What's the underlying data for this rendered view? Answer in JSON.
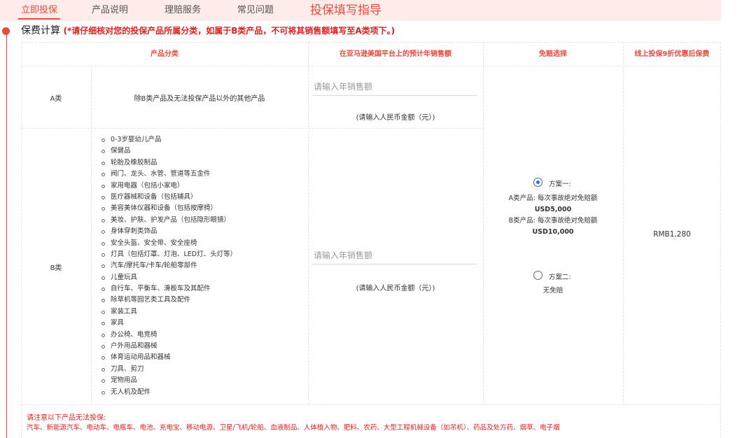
{
  "nav": {
    "tabs": [
      {
        "label": "立即投保",
        "active": true
      },
      {
        "label": "产品说明"
      },
      {
        "label": "理赔服务"
      },
      {
        "label": "常见问题"
      },
      {
        "label": "投保填写指导"
      }
    ],
    "active_color": "#e74b3c",
    "bar_color": "#fdecea"
  },
  "section": {
    "title": "保费计算",
    "note": "(*请仔细核对您的投保产品所属分类，如属于B类产品，不可将其销售额填写至A类项下。)"
  },
  "table": {
    "headers": [
      "产品分类",
      "在亚马逊美国平台上的预计年销售额",
      "免赔选择",
      "线上投保9折优惠后保费"
    ],
    "rows": {
      "a": {
        "label": "A类",
        "description": "除B类产品及无法投保产品以外的其他产品",
        "sales_placeholder": "请输入年销售额",
        "sales_hint": "(请输入人民币金额（元）)"
      },
      "b": {
        "label": "B类",
        "items": [
          "0-3岁婴幼儿产品",
          "保健品",
          "轮胎及橡胶制品",
          "阀门、龙头、水管、管道等五金件",
          "家用电器（包括小家电）",
          "医疗器械和设备（包括辅具）",
          "美容美体仪器和设备（包括按摩椅）",
          "美妆、护肤、护发产品（包括隐形眼镜）",
          "身体穿刺类饰品",
          "安全头盔、安全带、安全座椅",
          "灯具（包括灯罩、灯泡、LED灯、头灯等）",
          "汽车/摩托车/卡车/轮船零部件",
          "儿童玩具",
          "自行车、平衡车、滑板车及其配件",
          "除草机等园艺类工具及配件",
          "家装工具",
          "家具",
          "办公椅、电竞椅",
          "户外用品和器械",
          "体育运动用品和器械",
          "刀具、剪刀",
          "宠物用品",
          "无人机及配件"
        ],
        "sales_placeholder": "请输入年销售额",
        "sales_hint": "(请输入人民币金额（元）)"
      }
    },
    "deductible": {
      "plan1": {
        "label": "方案一:",
        "selected": true,
        "a_label": "A类产品:",
        "a_text": "每次事故绝对免赔额",
        "a_amount": "USD5,000",
        "b_label": "B类产品:",
        "b_text": "每次事故绝对免赔额",
        "b_amount": "USD10,000"
      },
      "plan2": {
        "label": "方案二:",
        "selected": false,
        "detail": "无免赔"
      }
    },
    "premium": "RMB1,280"
  },
  "warning": {
    "title": "请注意以下产品无法投保:",
    "list": "汽车、新能源汽车、电动车、电瓶车、电池、充电宝、移动电源、卫星/飞机/轮船、血液制品、人体植入物、肥料、农药、大型工程机械设备（如吊机）、药品及处方药、烟草、电子烟"
  }
}
